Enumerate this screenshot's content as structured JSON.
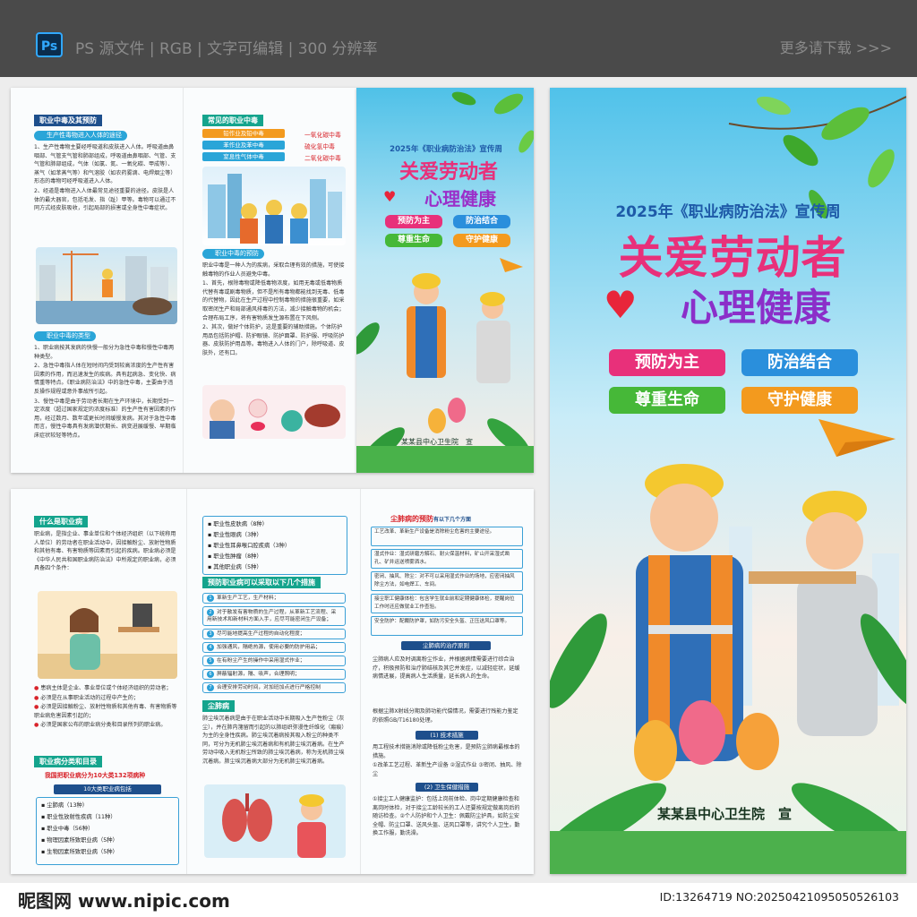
{
  "header": {
    "ps_badge": "Ps",
    "top_text": "PS 源文件 | RGB | 文字可编辑 | 300 分辨率",
    "download_text": "更多请下载 >>>"
  },
  "footer": {
    "watermark_logo": "昵图网 www.nipic.com",
    "watermark_id": "ID:13264719 NO:20250421095050526103"
  },
  "cover": {
    "week": "2025年《职业病防治法》宣传周",
    "title1": "关爱劳动者",
    "title2": "心理健康",
    "pills": [
      "预防为主",
      "防治结合",
      "尊重生命",
      "守护健康"
    ],
    "org": "某某县中心卫生院　宣"
  },
  "small_cover": {
    "week": "2025年《职业病防治法》宣传周",
    "title1": "关爱劳动者",
    "title2": "心理健康",
    "pills": [
      "预防为主",
      "防治结合",
      "尊重生命",
      "守护健康"
    ],
    "org": "某某县中心卫生院　宣"
  },
  "panel_a": {
    "title": "职业中毒及其预防",
    "sub1": "生产性毒物进入人体的途径",
    "para1": [
      "1、生产性毒物主要经呼吸道和皮肤进入人体。呼吸道由鼻咽部、气管支气管和肺部组成，呼吸道由鼻咽部、气管、支气管和肺部组成，气体（如氯、氮、一氧化碳、甲成等）、蒸气（如苯蒸气等）和气溶胶（如农药雾滴、电焊烟尘等）形态的毒物可经呼吸道进入人体。",
      "2、经道是毒物进入人体最常见途径重要的途径。皮肤是人体的最大器官，包括毛发、指（趾）甲等。毒物可以通过不同方式经皮肤吸收，引起局部的损害或全身性中毒症状。"
    ],
    "sub2": "职业中毒的类型",
    "para2": [
      "1、职业病按其发病的快慢一般分为急性中毒和慢性中毒两种类型。",
      "2、急性中毒指人体在短时间内受到较高浓度的生产性有害因素的作用，而迅速发生的疾病。具有起病急、变化快、病情重等特点。《职业病防治法》中的急性中毒，主要由于违反操作规程或意外事故所引起。",
      "3、慢性中毒是由于劳动者长期在生产环境中，长期受到一定浓度（超过国家规定的浓度标准）的生产性有害因素的作用，经过数月、数年或更长时间缓慢发病。其对于急性中毒而言，慢性中毒具有发病潜伏期长、病变进展缓慢、早期临床症状较轻等特点。"
    ]
  },
  "panel_b": {
    "title": "常见的职业中毒",
    "chips_left": [
      "铅作业及铅中毒",
      "苯作业及苯中毒",
      "窒息性气体中毒"
    ],
    "chips_right": [
      "一氧化碳中毒",
      "硫化氢中毒",
      "二氧化碳中毒"
    ],
    "sub": "职业中毒的预防",
    "para": [
      "职业中毒是一种人为的疾病，采取合理有效的措施，可使接触毒物的作业人员避免中毒。",
      "1、首先，根除毒物或降低毒物浓度，如用无毒或低毒物质代替有毒或剧毒物质，但不是所有毒物都能找到无毒、低毒的代替物，因此在生产过程中控制毒物的措施很重要，如采取密闭生产和局部通风排毒的方法，减少接触毒物的机会；合理布局工序，将有害物质发生源布置在下风侧。",
      "2、其次，做好个体防护，这是重要的辅助措施。个体防护用品包括防护帽、防护眼镜、防护面罩、防护服、呼吸防护器、皮肤防护用品等。毒物进入人体的门户，除呼吸道、皮肤外，还有口。"
    ]
  },
  "panel_c": {
    "title": "什么是职业病",
    "para1": "职业病，是指企业、事业单位和个体经济组织（以下统称用人单位）的劳动者在职业活动中，因接触粉尘、放射性物质和其他有毒、有害物质等因素而引起的疾病。职业病必须是《中华人民共和国职业病防治法》中所规定的职业病，必须具备四个条件：",
    "conditions": [
      "患病主体是企业、事业单位或个体经济组织的劳动者；",
      "必须是在从事职业活动的过程中产生的；",
      "必须是因接触粉尘、放射性物质和其他有毒、有害物质等职业病危害因素引起的；",
      "必须是国家公布的职业病分类和目录所列的职业病。"
    ],
    "title2": "职业病分类和目录",
    "red_head": "我国把职业病分为10大类132项病种",
    "cat_bar": "10大类职业病包括",
    "cats": [
      "尘肺病（13种）",
      "职业性放射性疾病（11种）",
      "职业中毒（56种）",
      "物理因素所致职业病（5种）",
      "生物因素所致职业病（5种）"
    ]
  },
  "panel_d": {
    "cats": [
      "职业性皮肤病（8种）",
      "职业性眼病（3种）",
      "职业性耳鼻喉口腔疾病（3种）",
      "职业性肿瘤（8种）",
      "其他职业病（5种）"
    ],
    "title": "预防职业病可以采取以下几个措施",
    "measures": [
      "革新生产工艺，生产材料；",
      "对于散发有害物质的生产过程，从革新工艺流程、采用新技术和新材料方面入手，应尽可能密闭生产设备；",
      "尽可能地提高生产过程的自动化程度；",
      "加强通风，隔绝热源，使用必要的防护用品；",
      "在有粉尘产生的操作中采用湿式作业；",
      "屏蔽辐射源，隔、吸声，合理照明；",
      "合理安排劳动时间，对加班加点进行严格控制"
    ],
    "title2": "尘肺病",
    "para": "肺尘埃沉着病是由于在职业活动中长期吸入生产性粉尘（灰尘），并在肺内潴留而引起的以肺组织弥漫性纤维化（瘢痕）为主的全身性疾病。肺尘埃沉着病按其吸入粉尘的种类不同，可分为无机肺尘埃沉着病和有机肺尘埃沉着病。在生产劳动中吸入无机粉尘所致的肺尘埃沉着病，称为无机肺尘埃沉着病。肺尘埃沉着病大部分为无机肺尘埃沉着病。"
  },
  "panel_e": {
    "title": "尘肺病的预防",
    "title_suffix": "有以下几个方面",
    "boxes": [
      "工艺改革、革新生产设备是消除粉尘危害的主要途径。",
      "湿式作业：湿式研磨方解石、耐火保温材料，矿山开采湿式凿孔、矿井运送喷雾洒水。",
      "密闭、抽风、除尘：对不可以采用湿式作业的场地，应密闭抽风除尘方法，如电焊工、车间。",
      "接尘职工健康体检：包含学生就业前和定期健康体检，提醒岗位工作时还应做就业工作查验。",
      "安全防护：配戴防护罩，如防污安全头盔、正压送风口罩等。"
    ],
    "band": "尘肺病的治疗原则",
    "treat": "尘肺病人应及时调离粉尘作业，并根据病情需要进行综合治疗，积极预防和治疗肺结核及其它并发症，以减轻症状，延缓病情进展，提高病人生活质量，延长病人的生命。",
    "assess": "根据尘肺X射线分期及肺功能代偿情况，需要进行残能力鉴定的依照GB/T16180处理。",
    "tech_band": "(1) 技术措施",
    "tech": "用工程技术措施消除或降低粉尘危害，是预防尘肺病最根本的措施。",
    "tech_items": "①改革工艺过程、革新生产设备 ②湿式作业 ③密闭、抽风、除尘",
    "hyg_band": "(2) 卫生保健措施",
    "hyg": "①接尘工人健康监护：包括上岗前体检、岗中定期健康检查和离岗时体检，对于接尘工龄较长的工人还要按规定做离岗后的随访检查。②个人防护和个人卫生：佩戴防尘护具，如防尘安全帽、防尘口罩、送风头盔、送风口罩等，讲究个人卫生，勤换工作服，勤洗澡。"
  },
  "colors": {
    "teal": "#14a48d",
    "navy": "#1e4f8c",
    "blue": "#2aa5d8",
    "red": "#d8242b",
    "pink": "#e8307a",
    "sky": "#2a8fdc",
    "green": "#46b838",
    "orange": "#f39a1e"
  }
}
